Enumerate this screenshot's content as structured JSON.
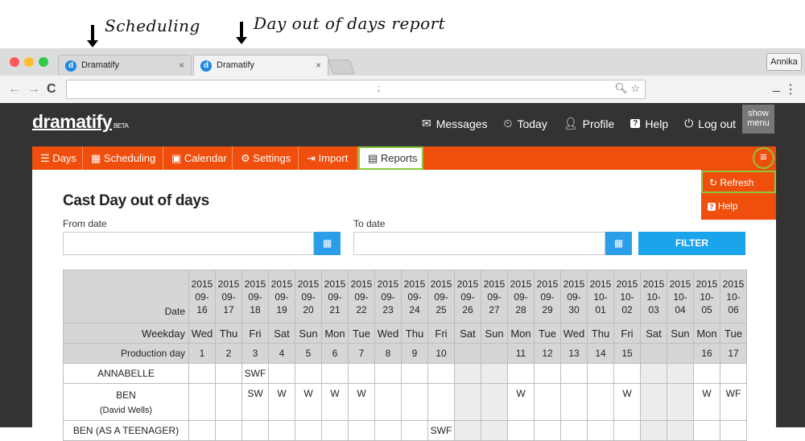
{
  "annotations": [
    "Scheduling",
    "Day out of days report"
  ],
  "browser": {
    "tabs": [
      {
        "title": "Dramatify",
        "close": "×"
      },
      {
        "title": "Dramatify",
        "close": "×"
      }
    ],
    "user": "Annika",
    "url": ";"
  },
  "app": {
    "logo": "dramatify",
    "logo_suffix": "BETA",
    "topnav": [
      {
        "label": "Messages",
        "icon": "messages-icon"
      },
      {
        "label": "Today",
        "icon": "calendar-today-icon"
      },
      {
        "label": "Profile",
        "icon": "user-icon"
      },
      {
        "label": "Help",
        "icon": "help-icon"
      },
      {
        "label": "Log out",
        "icon": "power-icon"
      }
    ],
    "show_menu": [
      "show",
      "menu"
    ],
    "tabs": [
      {
        "label": "Days",
        "icon": "list-icon"
      },
      {
        "label": "Scheduling",
        "icon": "grid-icon"
      },
      {
        "label": "Calendar",
        "icon": "calendar-icon"
      },
      {
        "label": "Settings",
        "icon": "gear-icon"
      },
      {
        "label": "Import",
        "icon": "import-icon"
      },
      {
        "label": "Reports",
        "icon": "report-icon"
      }
    ],
    "menu": [
      {
        "label": "Refresh",
        "icon": "refresh-icon"
      },
      {
        "label": "Help",
        "icon": "help-icon"
      }
    ]
  },
  "report": {
    "title": "Cast Day out of days",
    "from_label": "From date",
    "to_label": "To date",
    "filter": "FILTER",
    "row_labels": {
      "date": "Date",
      "weekday": "Weekday",
      "production_day": "Production day"
    },
    "columns": [
      {
        "y": "2015",
        "m": "09-",
        "d": "16",
        "wd": "Wed",
        "pd": "1",
        "weekend": false
      },
      {
        "y": "2015",
        "m": "09-",
        "d": "17",
        "wd": "Thu",
        "pd": "2",
        "weekend": false
      },
      {
        "y": "2015",
        "m": "09-",
        "d": "18",
        "wd": "Fri",
        "pd": "3",
        "weekend": false
      },
      {
        "y": "2015",
        "m": "09-",
        "d": "19",
        "wd": "Sat",
        "pd": "4",
        "weekend": false
      },
      {
        "y": "2015",
        "m": "09-",
        "d": "20",
        "wd": "Sun",
        "pd": "5",
        "weekend": false
      },
      {
        "y": "2015",
        "m": "09-",
        "d": "21",
        "wd": "Mon",
        "pd": "6",
        "weekend": false
      },
      {
        "y": "2015",
        "m": "09-",
        "d": "22",
        "wd": "Tue",
        "pd": "7",
        "weekend": false
      },
      {
        "y": "2015",
        "m": "09-",
        "d": "23",
        "wd": "Wed",
        "pd": "8",
        "weekend": false
      },
      {
        "y": "2015",
        "m": "09-",
        "d": "24",
        "wd": "Thu",
        "pd": "9",
        "weekend": false
      },
      {
        "y": "2015",
        "m": "09-",
        "d": "25",
        "wd": "Fri",
        "pd": "10",
        "weekend": false
      },
      {
        "y": "2015",
        "m": "09-",
        "d": "26",
        "wd": "Sat",
        "pd": "",
        "weekend": true
      },
      {
        "y": "2015",
        "m": "09-",
        "d": "27",
        "wd": "Sun",
        "pd": "",
        "weekend": true
      },
      {
        "y": "2015",
        "m": "09-",
        "d": "28",
        "wd": "Mon",
        "pd": "11",
        "weekend": false
      },
      {
        "y": "2015",
        "m": "09-",
        "d": "29",
        "wd": "Tue",
        "pd": "12",
        "weekend": false
      },
      {
        "y": "2015",
        "m": "09-",
        "d": "30",
        "wd": "Wed",
        "pd": "13",
        "weekend": false
      },
      {
        "y": "2015",
        "m": "10-",
        "d": "01",
        "wd": "Thu",
        "pd": "14",
        "weekend": false
      },
      {
        "y": "2015",
        "m": "10-",
        "d": "02",
        "wd": "Fri",
        "pd": "15",
        "weekend": false
      },
      {
        "y": "2015",
        "m": "10-",
        "d": "03",
        "wd": "Sat",
        "pd": "",
        "weekend": true
      },
      {
        "y": "2015",
        "m": "10-",
        "d": "04",
        "wd": "Sun",
        "pd": "",
        "weekend": true
      },
      {
        "y": "2015",
        "m": "10-",
        "d": "05",
        "wd": "Mon",
        "pd": "16",
        "weekend": false
      },
      {
        "y": "2015",
        "m": "10-",
        "d": "06",
        "wd": "Tue",
        "pd": "17",
        "weekend": false
      }
    ],
    "cast": [
      {
        "name": "ANNABELLE",
        "sub": "",
        "cells": {
          "2": "SWF"
        }
      },
      {
        "name": "BEN",
        "sub": "(David Wells)",
        "cells": {
          "2": "SW",
          "3": "W",
          "4": "W",
          "5": "W",
          "6": "W",
          "12": "W",
          "16": "W",
          "19": "W",
          "20": "WF"
        }
      },
      {
        "name": "BEN (AS A TEENAGER)",
        "sub": "",
        "cells": {
          "9": "SWF"
        }
      }
    ]
  }
}
